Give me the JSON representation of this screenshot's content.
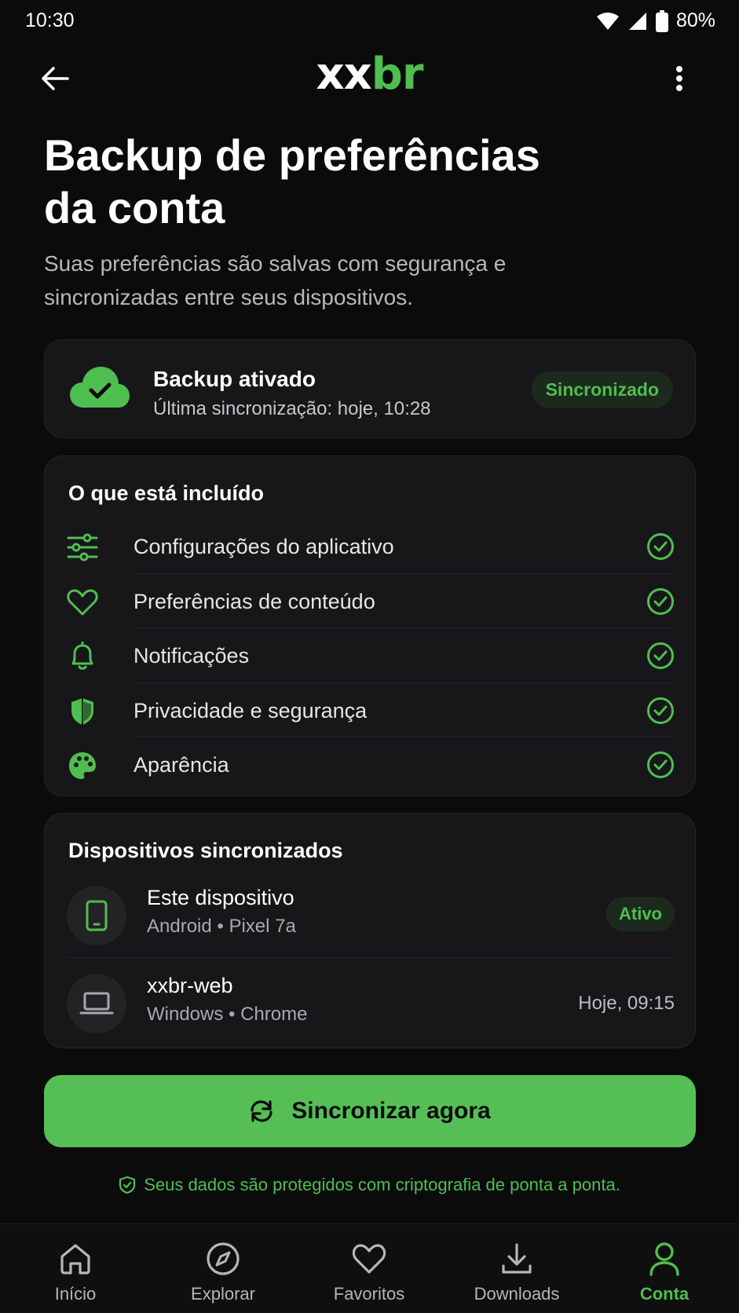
{
  "status_bar": {
    "time": "10:30",
    "battery": "80%"
  },
  "app_bar": {
    "logo_part1": "xx",
    "logo_part2": "br"
  },
  "header": {
    "title_line1": "Backup de preferências",
    "title_line2": "da conta",
    "subtitle_line1": "Suas preferências são salvas com segurança e",
    "subtitle_line2": "sincronizadas entre seus dispositivos."
  },
  "backup_card": {
    "title": "Backup ativado",
    "last_sync": "Última sincronização: hoje, 10:28",
    "badge": "Sincronizado"
  },
  "included": {
    "title": "O que está incluído",
    "items": [
      {
        "label": "Configurações do aplicativo",
        "icon": "sliders-icon",
        "included": true
      },
      {
        "label": "Preferências de conteúdo",
        "icon": "heart-icon",
        "included": true
      },
      {
        "label": "Notificações",
        "icon": "bell-icon",
        "included": true
      },
      {
        "label": "Privacidade e segurança",
        "icon": "shield-icon",
        "included": true
      },
      {
        "label": "Aparência",
        "icon": "palette-icon",
        "included": true
      }
    ]
  },
  "devices": {
    "title": "Dispositivos sincronizados",
    "items": [
      {
        "name": "Este dispositivo",
        "meta": "Android • Pixel 7a",
        "badge": "Ativo",
        "icon": "phone-icon"
      },
      {
        "name": "xxbr-web",
        "meta": "Windows • Chrome",
        "time": "Hoje, 09:15",
        "icon": "laptop-icon"
      }
    ]
  },
  "sync_button": {
    "label": "Sincronizar agora"
  },
  "secure_note": "Seus dados são protegidos com criptografia de ponta a ponta.",
  "bottom_nav": {
    "active": "Conta",
    "items": [
      {
        "label": "Início",
        "icon": "home-icon"
      },
      {
        "label": "Explorar",
        "icon": "compass-icon"
      },
      {
        "label": "Favoritos",
        "icon": "heart-icon"
      },
      {
        "label": "Downloads",
        "icon": "download-icon"
      },
      {
        "label": "Conta",
        "icon": "user-icon"
      }
    ]
  },
  "colors": {
    "accent": "#4fbe50",
    "background": "#0b0b0c",
    "card": "#17171a"
  }
}
